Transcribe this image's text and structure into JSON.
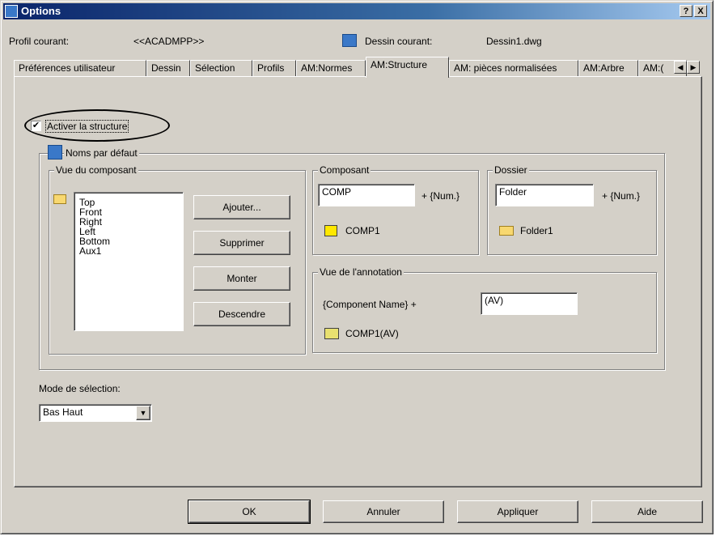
{
  "window": {
    "title": "Options",
    "help_btn": "?",
    "close_btn": "X"
  },
  "header": {
    "profile_label": "Profil courant:",
    "profile_value": "<<ACADMPP>>",
    "drawing_label": "Dessin courant:",
    "drawing_value": "Dessin1.dwg"
  },
  "tabs": [
    {
      "label": "Préférences utilisateur"
    },
    {
      "label": "Dessin"
    },
    {
      "label": "Sélection"
    },
    {
      "label": "Profils"
    },
    {
      "label": "AM:Normes"
    },
    {
      "label": "AM:Structure",
      "active": true
    },
    {
      "label": "AM: pièces normalisées"
    },
    {
      "label": "AM:Arbre"
    },
    {
      "label": "AM:("
    }
  ],
  "tab_scroll": {
    "left": "◀",
    "right": "▶"
  },
  "structure": {
    "enable_checked": true,
    "enable_label": "Activer la structure",
    "default_names_title": "Noms par défaut",
    "component_view": {
      "title": "Vue du composant",
      "items": [
        "Top",
        "Front",
        "Right",
        "Left",
        "Bottom",
        "Aux1"
      ],
      "buttons": {
        "add": "Ajouter...",
        "delete": "Supprimer",
        "up": "Monter",
        "down": "Descendre"
      }
    },
    "component": {
      "title": "Composant",
      "value": "COMP",
      "suffix": "+ {Num.}",
      "preview": "COMP1"
    },
    "folder": {
      "title": "Dossier",
      "value": "Folder",
      "suffix": "+ {Num.}",
      "preview": "Folder1"
    },
    "annotation_view": {
      "title": "Vue de l'annotation",
      "prefix": "{Component Name} +",
      "value": "(AV)",
      "preview": "COMP1(AV)"
    },
    "selection_mode": {
      "label": "Mode de sélection:",
      "value": "Bas Haut"
    }
  },
  "footer": {
    "ok": "OK",
    "cancel": "Annuler",
    "apply": "Appliquer",
    "help": "Aide"
  }
}
